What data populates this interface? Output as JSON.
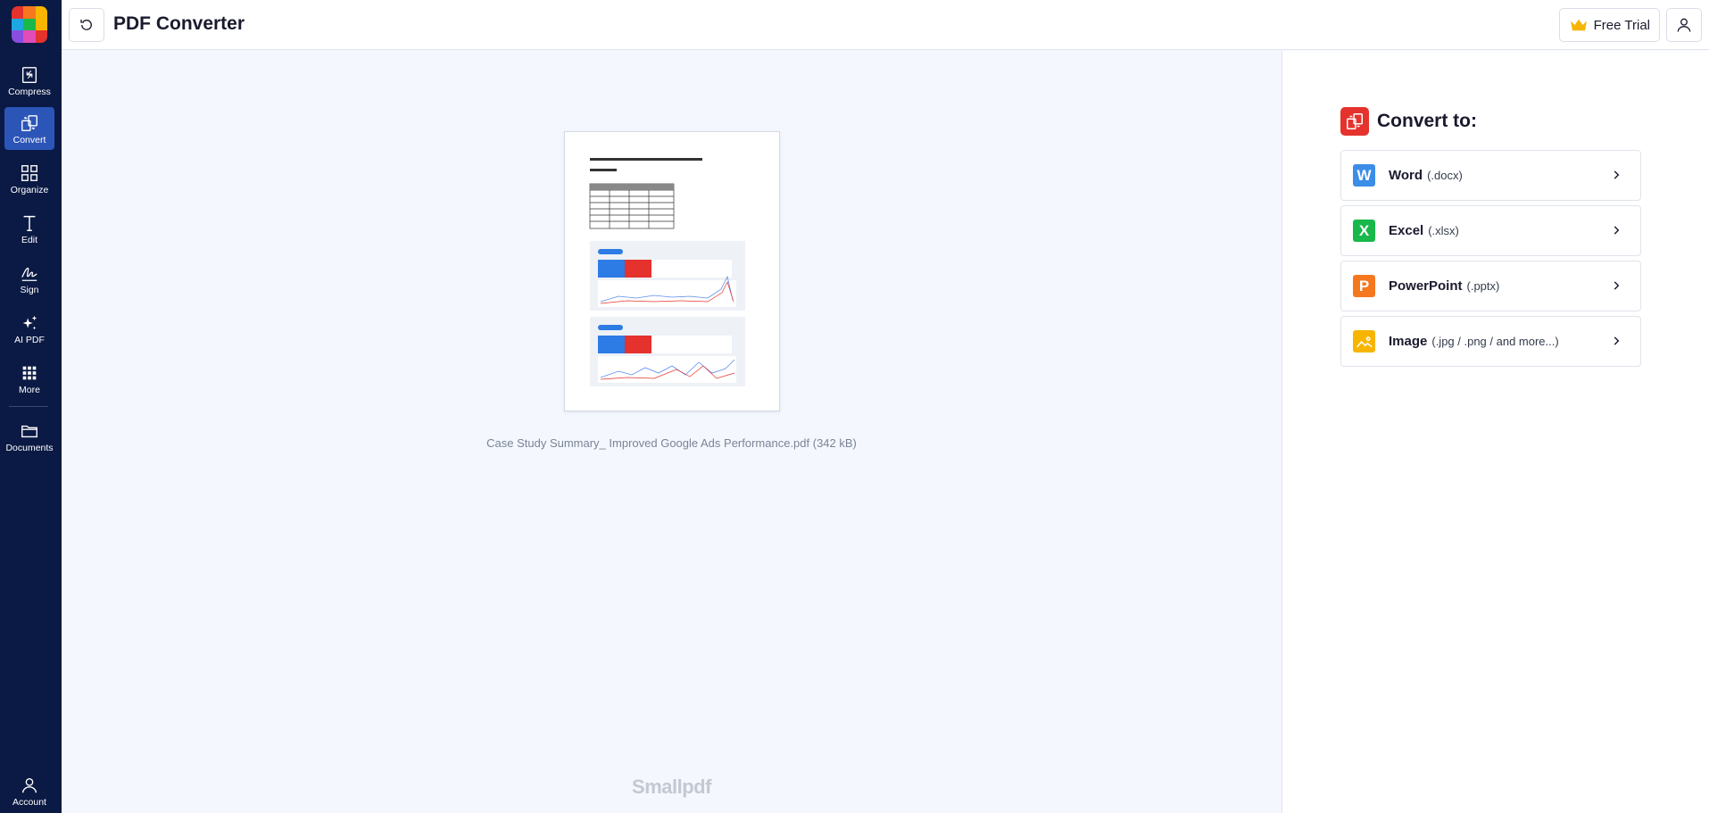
{
  "app": {
    "title": "PDF Converter"
  },
  "header": {
    "free_trial_label": "Free Trial"
  },
  "sidebar": {
    "items": [
      {
        "label": "Compress",
        "icon": "compress-icon"
      },
      {
        "label": "Convert",
        "icon": "convert-icon",
        "active": true
      },
      {
        "label": "Organize",
        "icon": "grid-icon"
      },
      {
        "label": "Edit",
        "icon": "text-edit-icon"
      },
      {
        "label": "Sign",
        "icon": "signature-icon"
      },
      {
        "label": "AI PDF",
        "icon": "sparkles-icon"
      },
      {
        "label": "More",
        "icon": "apps-icon"
      },
      {
        "label": "Documents",
        "icon": "folder-icon"
      },
      {
        "label": "Account",
        "icon": "user-icon"
      }
    ]
  },
  "main": {
    "file_caption": "Case Study Summary_ Improved Google Ads Performance.pdf (342 kB)",
    "watermark": "Smallpdf"
  },
  "convert_panel": {
    "title": "Convert to:",
    "options": [
      {
        "name": "Word",
        "ext": "(.docx)",
        "letter": "W",
        "color": "#3b8de8"
      },
      {
        "name": "Excel",
        "ext": "(.xlsx)",
        "letter": "X",
        "color": "#18b84a"
      },
      {
        "name": "PowerPoint",
        "ext": "(.pptx)",
        "letter": "P",
        "color": "#f5781f"
      },
      {
        "name": "Image",
        "ext": "(.jpg / .png / and more...)",
        "letter": "",
        "color": "#f7b500"
      }
    ]
  },
  "colors": {
    "sidebar_bg": "#0b1a44",
    "sidebar_active": "#2c55b8",
    "accent_red": "#e5322d",
    "main_bg": "#f4f7fe"
  }
}
